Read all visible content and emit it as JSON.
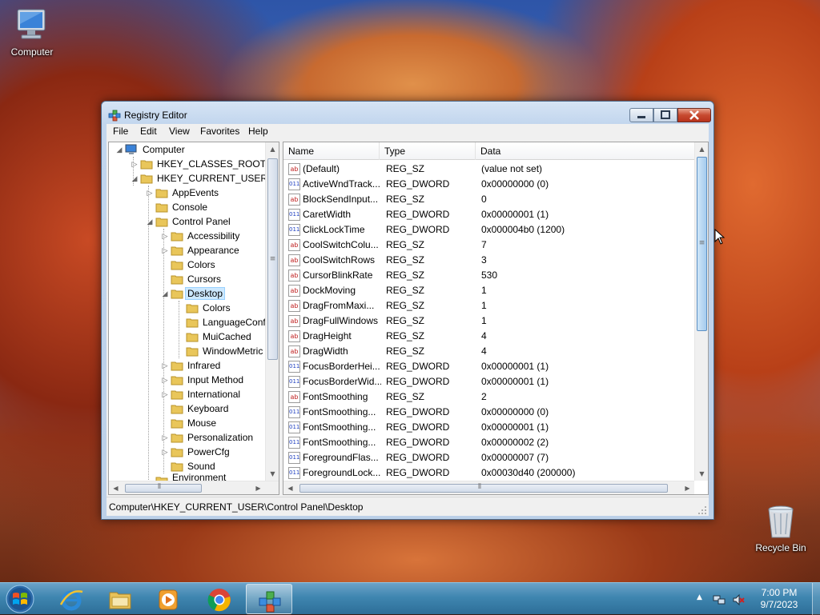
{
  "desktop": {
    "icons": [
      {
        "label": "Computer",
        "icon": "computer-icon"
      },
      {
        "label": "Recycle Bin",
        "icon": "recycle-bin-icon"
      }
    ]
  },
  "window": {
    "title": "Registry Editor",
    "menu": [
      "File",
      "Edit",
      "View",
      "Favorites",
      "Help"
    ]
  },
  "tree": {
    "root": "Computer",
    "hkcr": "HKEY_CLASSES_ROOT",
    "hkcu": "HKEY_CURRENT_USER",
    "appevents": "AppEvents",
    "console": "Console",
    "control_panel": "Control Panel",
    "accessibility": "Accessibility",
    "appearance": "Appearance",
    "colors": "Colors",
    "cursors": "Cursors",
    "desktop": "Desktop",
    "desktop_colors": "Colors",
    "language_config": "LanguageConf",
    "muicached": "MuiCached",
    "window_metrics": "WindowMetric",
    "infrared": "Infrared",
    "input_method": "Input Method",
    "international": "International",
    "keyboard": "Keyboard",
    "mouse": "Mouse",
    "personalization": "Personalization",
    "powercfg": "PowerCfg",
    "sound": "Sound",
    "environment": "Environment",
    "selected": "Desktop"
  },
  "list": {
    "columns": [
      "Name",
      "Type",
      "Data"
    ],
    "rows": [
      {
        "name": "(Default)",
        "type": "REG_SZ",
        "data": "(value not set)"
      },
      {
        "name": "ActiveWndTrack...",
        "type": "REG_DWORD",
        "data": "0x00000000 (0)"
      },
      {
        "name": "BlockSendInput...",
        "type": "REG_SZ",
        "data": "0"
      },
      {
        "name": "CaretWidth",
        "type": "REG_DWORD",
        "data": "0x00000001 (1)"
      },
      {
        "name": "ClickLockTime",
        "type": "REG_DWORD",
        "data": "0x000004b0 (1200)"
      },
      {
        "name": "CoolSwitchColu...",
        "type": "REG_SZ",
        "data": "7"
      },
      {
        "name": "CoolSwitchRows",
        "type": "REG_SZ",
        "data": "3"
      },
      {
        "name": "CursorBlinkRate",
        "type": "REG_SZ",
        "data": "530"
      },
      {
        "name": "DockMoving",
        "type": "REG_SZ",
        "data": "1"
      },
      {
        "name": "DragFromMaxi...",
        "type": "REG_SZ",
        "data": "1"
      },
      {
        "name": "DragFullWindows",
        "type": "REG_SZ",
        "data": "1"
      },
      {
        "name": "DragHeight",
        "type": "REG_SZ",
        "data": "4"
      },
      {
        "name": "DragWidth",
        "type": "REG_SZ",
        "data": "4"
      },
      {
        "name": "FocusBorderHei...",
        "type": "REG_DWORD",
        "data": "0x00000001 (1)"
      },
      {
        "name": "FocusBorderWid...",
        "type": "REG_DWORD",
        "data": "0x00000001 (1)"
      },
      {
        "name": "FontSmoothing",
        "type": "REG_SZ",
        "data": "2"
      },
      {
        "name": "FontSmoothing...",
        "type": "REG_DWORD",
        "data": "0x00000000 (0)"
      },
      {
        "name": "FontSmoothing...",
        "type": "REG_DWORD",
        "data": "0x00000001 (1)"
      },
      {
        "name": "FontSmoothing...",
        "type": "REG_DWORD",
        "data": "0x00000002 (2)"
      },
      {
        "name": "ForegroundFlas...",
        "type": "REG_DWORD",
        "data": "0x00000007 (7)"
      },
      {
        "name": "ForegroundLock...",
        "type": "REG_DWORD",
        "data": "0x00030d40 (200000)"
      }
    ]
  },
  "status_bar": {
    "path": "Computer\\HKEY_CURRENT_USER\\Control Panel\\Desktop"
  },
  "taskbar": {
    "buttons": [
      "start-button",
      "internet-explorer",
      "windows-explorer",
      "windows-media-player",
      "google-chrome",
      "registry-editor"
    ],
    "active": "registry-editor",
    "time": "7:00 PM",
    "date": "9/7/2023"
  }
}
